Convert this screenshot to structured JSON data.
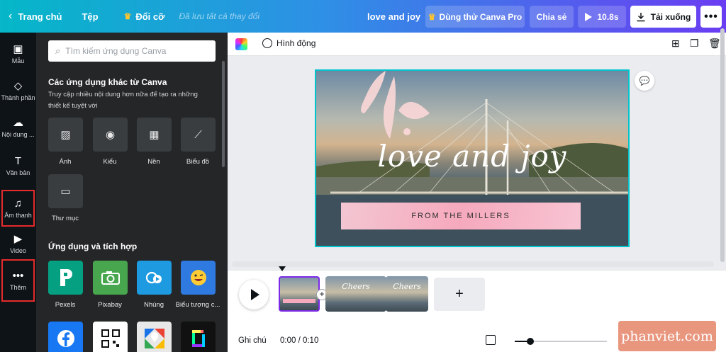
{
  "topbar": {
    "home": "Trang chủ",
    "file": "Tệp",
    "resize": "Đổi cỡ",
    "saved": "Đã lưu tất cả thay đổi",
    "title": "love and joy",
    "try_pro": "Dùng thử Canva Pro",
    "share": "Chia sẻ",
    "play_duration": "10.8s",
    "download": "Tải xuống",
    "more": "•••"
  },
  "rail": {
    "items": [
      {
        "label": "Mẫu",
        "icon": "template-icon"
      },
      {
        "label": "Thành phần",
        "icon": "elements-icon"
      },
      {
        "label": "Nội dung ...",
        "icon": "upload-icon"
      },
      {
        "label": "Văn bản",
        "icon": "text-icon"
      },
      {
        "label": "Âm thanh",
        "icon": "music-icon"
      },
      {
        "label": "Video",
        "icon": "video-icon"
      },
      {
        "label": "Thêm",
        "icon": "more-icon"
      }
    ],
    "highlight_color": "#e52b2b"
  },
  "panel": {
    "search_placeholder": "Tìm kiếm ứng dụng Canva",
    "section1_title": "Các ứng dụng khác từ Canva",
    "section1_desc": "Truy cập nhiều nội dung hơn nữa để tạo ra những thiết kế tuyệt vời",
    "apps1": [
      {
        "label": "Ảnh",
        "icon": "image-icon"
      },
      {
        "label": "Kiểu",
        "icon": "palette-icon"
      },
      {
        "label": "Nền",
        "icon": "background-icon"
      },
      {
        "label": "Biểu đồ",
        "icon": "chart-icon"
      },
      {
        "label": "Thư mục",
        "icon": "folder-icon"
      }
    ],
    "section2_title": "Ứng dụng và tích hợp",
    "apps2": [
      {
        "label": "Pexels",
        "icon": "pexels-icon",
        "color": "#05a081"
      },
      {
        "label": "Pixabay",
        "icon": "pixabay-icon",
        "color": "#48a74e"
      },
      {
        "label": "Nhúng",
        "icon": "embed-icon",
        "color": "#1e9be0"
      },
      {
        "label": "Biểu tượng c...",
        "icon": "emoji-icon",
        "color": "#2f7ae0"
      }
    ]
  },
  "toolbar": {
    "animate": "Hình động"
  },
  "design": {
    "script": "love and joy",
    "banner": "FROM THE MILLERS"
  },
  "timeline": {
    "thumb_labels": [
      "Cheers",
      "Cheers"
    ],
    "add_scene": "+",
    "notes": "Ghi chú",
    "time": "0:00 / 0:10",
    "zoom_fraction": 0.17
  },
  "watermark": "phanviet.com",
  "colors": {
    "accent": "#7d2ae8",
    "canvas_border": "#00c4cc",
    "panel_bg": "#252627"
  }
}
